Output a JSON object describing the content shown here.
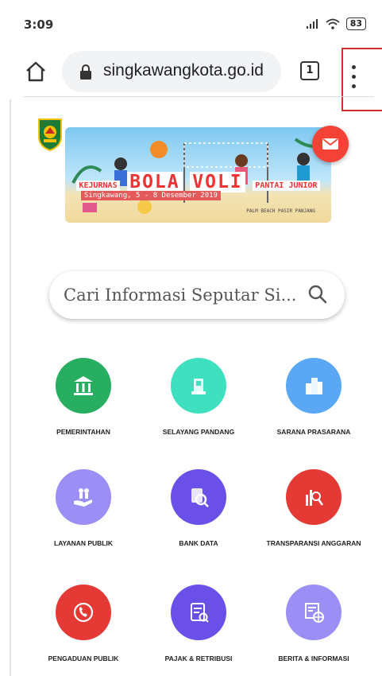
{
  "status_bar": {
    "time": "3:09",
    "battery": "83"
  },
  "url_bar": {
    "url": "singkawangkota.go.id",
    "tab_count": "1"
  },
  "banner": {
    "prefix": "KEJURNAS",
    "title_a": "BOLA",
    "title_b": "VOLI",
    "suffix": "PANTAI JUNIOR",
    "subtitle": "Singkawang, 5 - 8 Desember 2019",
    "location": "PALM BEACH PASIR PANJANG"
  },
  "search": {
    "placeholder": "Cari Informasi Seputar Si..."
  },
  "menu": [
    {
      "label": "PEMERINTAHAN",
      "color": "#27ae60",
      "icon": "building-columns-icon"
    },
    {
      "label": "SELAYANG PANDANG",
      "color": "#3ee0c0",
      "icon": "monument-icon"
    },
    {
      "label": "SARANA PRASARANA",
      "color": "#5aa8f5",
      "icon": "city-buildings-icon"
    },
    {
      "label": "LAYANAN PUBLIK",
      "color": "#9b8ff5",
      "icon": "hand-people-icon"
    },
    {
      "label": "BANK DATA",
      "color": "#6a4fe8",
      "icon": "data-search-icon"
    },
    {
      "label": "TRANSPARANSI ANGGARAN",
      "color": "#e53935",
      "icon": "bar-chart-icon"
    },
    {
      "label": "PENGADUAN PUBLIK",
      "color": "#e53935",
      "icon": "phone-call-icon"
    },
    {
      "label": "PAJAK & RETRIBUSI",
      "color": "#6a4fe8",
      "icon": "tax-document-icon"
    },
    {
      "label": "BERITA & INFORMASI",
      "color": "#9b8ff5",
      "icon": "news-globe-icon"
    }
  ]
}
